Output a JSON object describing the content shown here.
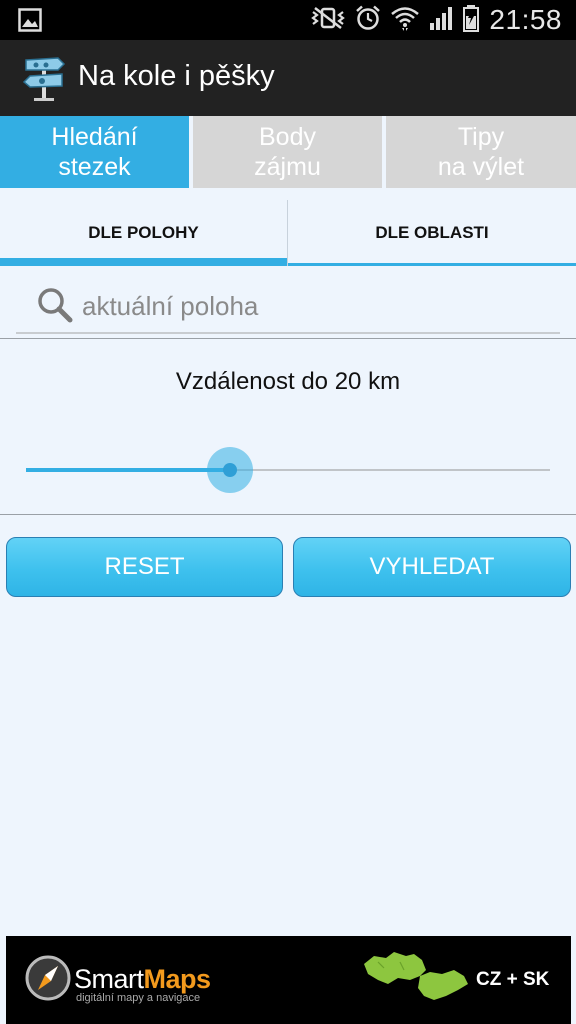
{
  "status_bar": {
    "time": "21:58",
    "icons": [
      "gallery-icon",
      "vibrate-mute-icon",
      "alarm-icon",
      "wifi-icon",
      "signal-icon",
      "battery-icon"
    ]
  },
  "action_bar": {
    "title": "Na kole i pěšky",
    "logo_icon": "signpost-icon"
  },
  "top_tabs": [
    {
      "line1": "Hledání",
      "line2": "stezek",
      "active": true
    },
    {
      "line1": "Body",
      "line2": "zájmu",
      "active": false
    },
    {
      "line1": "Tipy",
      "line2": "na výlet",
      "active": false
    }
  ],
  "sub_tabs": [
    {
      "label": "DLE POLOHY",
      "active": true
    },
    {
      "label": "DLE OBLASTI",
      "active": false
    }
  ],
  "search": {
    "placeholder": "aktuální poloha",
    "value": ""
  },
  "distance": {
    "label": "Vzdálenost do 20 km",
    "slider_fraction": 0.39
  },
  "buttons": {
    "reset": "RESET",
    "search": "VYHLEDAT"
  },
  "footer_ad": {
    "brand_part1": "Smart",
    "brand_part2": "Maps",
    "tagline": "digitální mapy a navigace",
    "region": "CZ + SK",
    "colors": {
      "brand_orange": "#f39a1d",
      "map_green": "#8dc63f"
    }
  },
  "colors": {
    "accent": "#33aee3",
    "tab_inactive": "#d6d6d6",
    "background": "#eef5fd"
  }
}
